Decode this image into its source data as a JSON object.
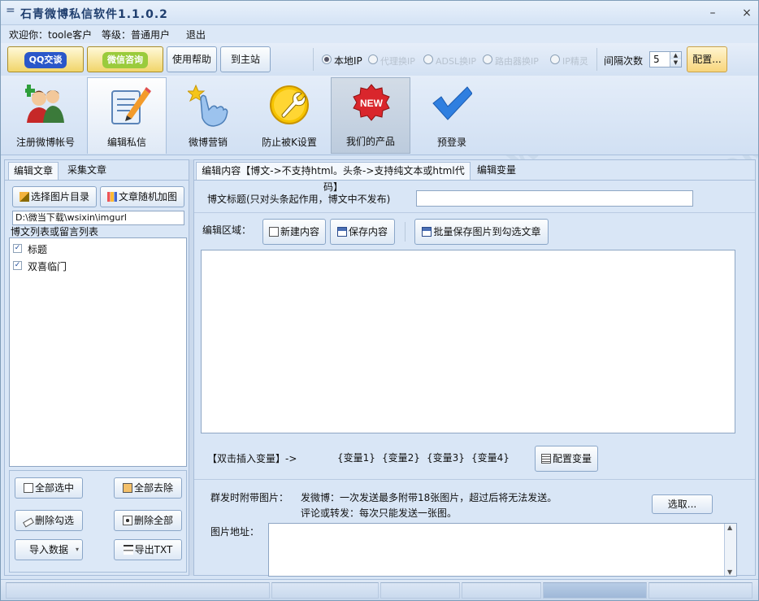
{
  "window": {
    "title": "石青微博私信软件1.1.0.2",
    "menu_glyph": "=",
    "min_glyph": "–",
    "close_glyph": "×"
  },
  "userbar": {
    "welcome": "欢迎你：toole客户",
    "level": "等级：普通用户",
    "logout": "退出"
  },
  "toolbar": {
    "qq_label": "QQ交谈",
    "wechat_label": "微信咨询",
    "help_label": "使用帮助",
    "home_label": "到主站",
    "ip_options": [
      "本地IP",
      "代理换IP",
      "ADSL换IP",
      "路由器换IP",
      "IP精灵"
    ],
    "ip_selected": "本地IP",
    "interval_label": "间隔次数",
    "interval_value": "5",
    "config_label": "配置..."
  },
  "modules": [
    {
      "label": "注册微博帐号",
      "icon": "users-add-icon"
    },
    {
      "label": "编辑私信",
      "icon": "edit-document-icon"
    },
    {
      "label": "微博营销",
      "icon": "hand-star-icon"
    },
    {
      "label": "防止被K设置",
      "icon": "wrench-icon"
    },
    {
      "label": "我们的产品",
      "icon": "new-badge-icon"
    },
    {
      "label": "预登录",
      "icon": "checkmark-icon"
    }
  ],
  "new_badge": "NEW",
  "left": {
    "tabs": [
      "编辑文章",
      "采集文章"
    ],
    "choose_dir": "选择图片目录",
    "random_img": "文章随机加图",
    "path": "D:\\微当下载\\wsixin\\imgurl",
    "list_title": "博文列表或留言列表",
    "items": [
      "标题",
      "双喜临门"
    ],
    "select_all": "全部选中",
    "deselect_all": "全部去除",
    "delete_checked": "删除勾选",
    "delete_all": "删除全部",
    "import_data": "导入数据",
    "export_txt": "导出TXT"
  },
  "right": {
    "tabs": [
      "编辑内容【博文->不支持html。头条->支持纯文本或html代码】",
      "编辑变量"
    ],
    "title_label": "博文标题(只对头条起作用，博文中不发布)",
    "edit_area_label": "编辑区域：",
    "new_content": "新建内容",
    "save_content": "保存内容",
    "batch_save": "批量保存图片到勾选文章",
    "insert_var_label": "【双击插入变量】->",
    "vars": [
      "{变量1}",
      "{变量2}",
      "{变量3}",
      "{变量4}"
    ],
    "config_var": "配置变量",
    "attach_label": "群发时附带图片：",
    "attach_note1": "发微博：一次发送最多附带18张图片，超过后将无法发送。",
    "attach_note2": "评论或转发：每次只能发送一张图。",
    "pick_label": "选取...",
    "img_addr_label": "图片地址："
  },
  "watermark": "WWW.WEIDOWN.COM"
}
